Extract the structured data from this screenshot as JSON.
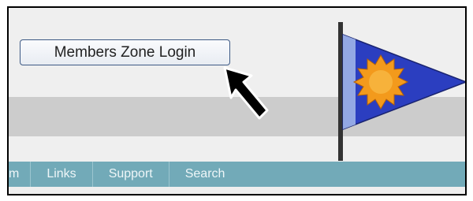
{
  "login": {
    "label": "Members Zone Login"
  },
  "nav": {
    "items": [
      {
        "label": "m"
      },
      {
        "label": "Links"
      },
      {
        "label": "Support"
      },
      {
        "label": "Search"
      }
    ]
  },
  "icons": {
    "flag": "pennant-flag-with-sun",
    "cursor": "arrow-cursor"
  },
  "colors": {
    "nav_bar": "#72aab8",
    "flag_blue": "#2b3ec0",
    "sun_orange": "#f39a1c",
    "band_gray": "#cccccc"
  }
}
